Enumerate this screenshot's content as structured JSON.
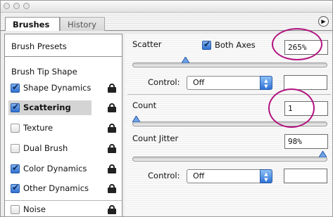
{
  "window": {
    "tabs": [
      {
        "label": "Brushes",
        "active": true
      },
      {
        "label": "History",
        "active": false
      }
    ],
    "menu_icon": "flyout-menu-icon"
  },
  "sidebar": {
    "presets_label": "Brush Presets",
    "tip_shape_label": "Brush Tip Shape",
    "items": [
      {
        "label": "Shape Dynamics",
        "checked": true,
        "selected": false
      },
      {
        "label": "Scattering",
        "checked": true,
        "selected": true
      },
      {
        "label": "Texture",
        "checked": false,
        "selected": false
      },
      {
        "label": "Dual Brush",
        "checked": false,
        "selected": false
      },
      {
        "label": "Color Dynamics",
        "checked": true,
        "selected": false
      },
      {
        "label": "Other Dynamics",
        "checked": true,
        "selected": false
      },
      {
        "label": "Noise",
        "checked": false,
        "selected": false
      }
    ]
  },
  "scatter": {
    "label": "Scatter",
    "both_axes_label": "Both Axes",
    "both_axes_checked": true,
    "value": "265%",
    "slider_level": 0.265,
    "control_label": "Control:",
    "control_value": "Off",
    "control_amount": ""
  },
  "count": {
    "label": "Count",
    "value": "1",
    "slider_level": 0.0
  },
  "count_jitter": {
    "label": "Count Jitter",
    "value": "98%",
    "slider_level": 0.98,
    "control_label": "Control:",
    "control_value": "Off",
    "control_amount": ""
  },
  "annotations": {
    "highlight_color": "#b2137f"
  }
}
